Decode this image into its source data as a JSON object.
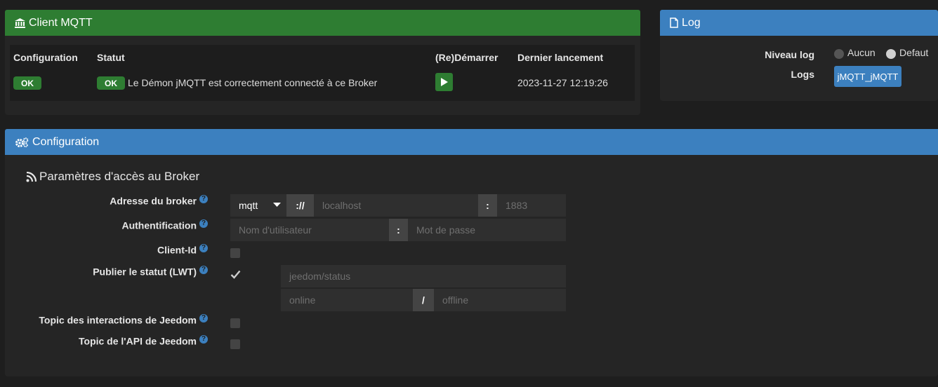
{
  "client": {
    "title": "Client MQTT",
    "headers": {
      "configuration": "Configuration",
      "statut": "Statut",
      "restart": "(Re)Démarrer",
      "last": "Dernier lancement"
    },
    "config_badge": "OK",
    "statut_badge": "OK",
    "statut_text": "Le Démon jMQTT est correctement connecté à ce Broker",
    "last_launch": "2023-11-27 12:19:26"
  },
  "log": {
    "title": "Log",
    "level_label": "Niveau log",
    "options": [
      "Aucun",
      "Defaut"
    ],
    "logs_label": "Logs",
    "logs_button": "jMQTT_jMQTT"
  },
  "config": {
    "title": "Configuration",
    "subtitle": "Paramètres d'accès au Broker",
    "fields": {
      "address": "Adresse du broker",
      "auth": "Authentification",
      "client_id": "Client-Id",
      "lwt": "Publier le statut (LWT)",
      "interactions": "Topic des interactions de Jeedom",
      "api": "Topic de l'API de Jeedom"
    },
    "protocol": "mqtt",
    "scheme_sep": "://",
    "host_placeholder": "localhost",
    "port_sep": ":",
    "port_placeholder": "1883",
    "user_placeholder": "Nom d'utilisateur",
    "auth_sep": ":",
    "pass_placeholder": "Mot de passe",
    "lwt_topic_placeholder": "jeedom/status",
    "lwt_online_placeholder": "online",
    "lwt_sep": "/",
    "lwt_offline_placeholder": "offline",
    "help": "?"
  },
  "colors": {
    "green": "#2e7d32",
    "blue": "#3c80bf",
    "bg": "#1e1e1e",
    "panel": "#252525"
  }
}
